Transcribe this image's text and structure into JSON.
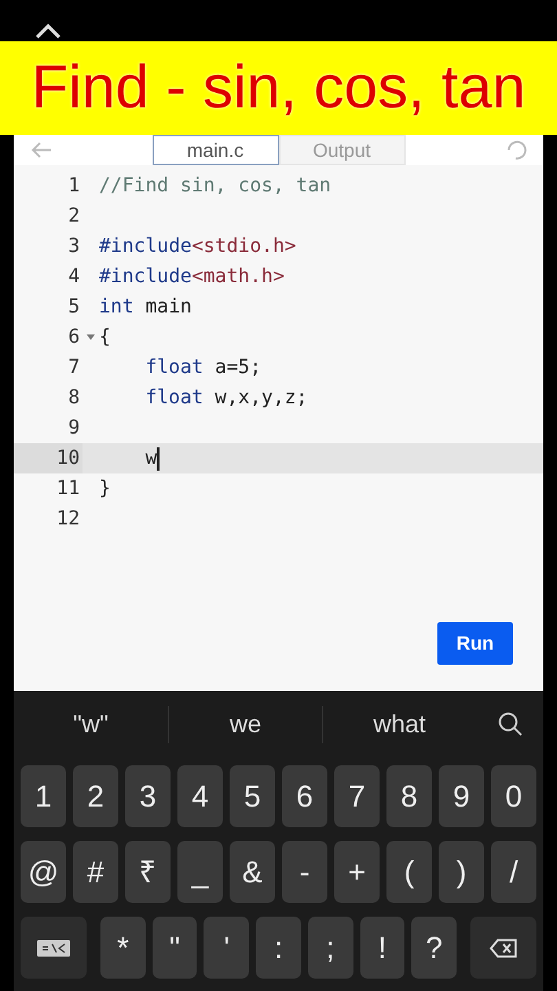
{
  "banner": {
    "text": "Find - sin, cos, tan"
  },
  "tabs": [
    {
      "label": "main.c",
      "selected": true
    },
    {
      "label": "Output",
      "selected": false
    }
  ],
  "editor": {
    "lines": [
      {
        "number": "1",
        "active": false,
        "foldable": false,
        "indented": false,
        "tokens": [
          {
            "text": "//Find sin, cos, tan",
            "kind": "comment"
          }
        ]
      },
      {
        "number": "2",
        "active": false,
        "foldable": false
      },
      {
        "number": "3",
        "active": false,
        "foldable": false,
        "indented": false,
        "tokens": [
          {
            "text": "#include",
            "kind": "keyword"
          },
          {
            "text": "<stdio.h>",
            "kind": "string"
          }
        ]
      },
      {
        "number": "4",
        "active": false,
        "foldable": false,
        "indented": false,
        "tokens": [
          {
            "text": "#include",
            "kind": "keyword"
          },
          {
            "text": "<math.h>",
            "kind": "string"
          }
        ]
      },
      {
        "number": "5",
        "active": false,
        "foldable": false,
        "indented": false,
        "tokens": [
          {
            "text": "int",
            "kind": "keyword"
          },
          {
            "text": " main",
            "kind": "plain"
          }
        ]
      },
      {
        "number": "6",
        "active": false,
        "foldable": true,
        "indented": false,
        "tokens": [
          {
            "text": "{",
            "kind": "plain"
          }
        ]
      },
      {
        "number": "7",
        "active": false,
        "foldable": false,
        "indented": true,
        "tokens": [
          {
            "text": "float",
            "kind": "keyword"
          },
          {
            "text": " a=5;",
            "kind": "plain"
          }
        ]
      },
      {
        "number": "8",
        "active": false,
        "foldable": false,
        "indented": true,
        "tokens": [
          {
            "text": "float",
            "kind": "keyword"
          },
          {
            "text": " w,x,y,z;",
            "kind": "plain"
          }
        ]
      },
      {
        "number": "9",
        "active": false,
        "foldable": false
      },
      {
        "number": "10",
        "active": true,
        "foldable": false,
        "indented": true,
        "tokens": [
          {
            "text": "w",
            "kind": "plain"
          }
        ]
      },
      {
        "number": "11",
        "active": false,
        "foldable": false,
        "indented": false,
        "tokens": [
          {
            "text": "}",
            "kind": "plain"
          }
        ]
      },
      {
        "number": "12",
        "active": false,
        "foldable": false
      }
    ]
  },
  "run_button": {
    "label": "Run"
  },
  "keyboard": {
    "suggestions": [
      "\"w\"",
      "we",
      "what"
    ],
    "rows": [
      [
        {
          "label": "1",
          "kind": "char"
        },
        {
          "label": "2",
          "kind": "char"
        },
        {
          "label": "3",
          "kind": "char"
        },
        {
          "label": "4",
          "kind": "char"
        },
        {
          "label": "5",
          "kind": "char"
        },
        {
          "label": "6",
          "kind": "char"
        },
        {
          "label": "7",
          "kind": "char"
        },
        {
          "label": "8",
          "kind": "char"
        },
        {
          "label": "9",
          "kind": "char"
        },
        {
          "label": "0",
          "kind": "char"
        }
      ],
      [
        {
          "label": "@",
          "kind": "char"
        },
        {
          "label": "#",
          "kind": "char"
        },
        {
          "label": "₹",
          "kind": "char"
        },
        {
          "label": "_",
          "kind": "char"
        },
        {
          "label": "&",
          "kind": "char"
        },
        {
          "label": "-",
          "kind": "char"
        },
        {
          "label": "+",
          "kind": "char"
        },
        {
          "label": "(",
          "kind": "char"
        },
        {
          "label": ")",
          "kind": "char"
        },
        {
          "label": "/",
          "kind": "char"
        }
      ],
      [
        {
          "kind": "symbols"
        },
        {
          "label": "*",
          "kind": "char"
        },
        {
          "label": "\"",
          "kind": "char"
        },
        {
          "label": "'",
          "kind": "char"
        },
        {
          "label": ":",
          "kind": "char"
        },
        {
          "label": ";",
          "kind": "char"
        },
        {
          "label": "!",
          "kind": "char"
        },
        {
          "label": "?",
          "kind": "char"
        },
        {
          "kind": "backspace"
        }
      ]
    ]
  }
}
